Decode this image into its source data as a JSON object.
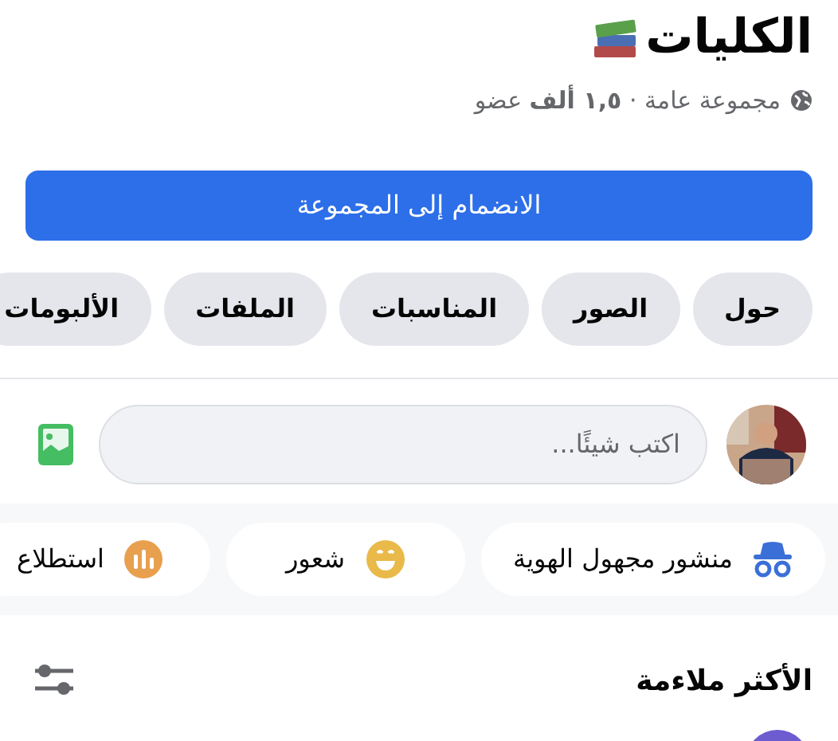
{
  "group": {
    "title": "الكليات",
    "subtitle": "مجموعة عامة · **١,٥ ألف** عضو"
  },
  "join_button": "الانضمام إلى المجموعة",
  "tabs": [
    "حول",
    "الصور",
    "المناسبات",
    "الملفات",
    "الألبومات"
  ],
  "composer": {
    "placeholder": "اكتب شيئًا..."
  },
  "actions": [
    {
      "kind": "anonymous",
      "label": "منشور مجهول الهوية"
    },
    {
      "kind": "feeling",
      "label": "شعور"
    },
    {
      "kind": "poll",
      "label": "استطلاع"
    }
  ],
  "feed": {
    "sort_label": "الأكثر ملاءمة"
  }
}
